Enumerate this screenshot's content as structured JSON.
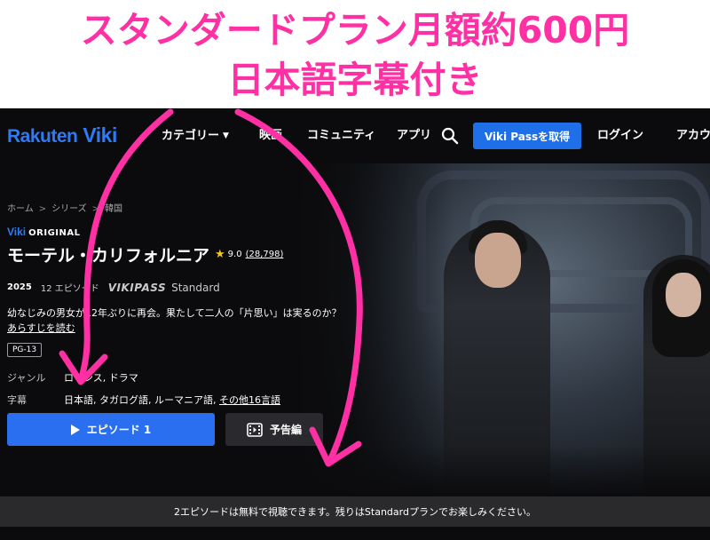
{
  "headline": {
    "line1": "スタンダードプラン月額約600円",
    "line2": "日本語字幕付き"
  },
  "nav": {
    "logo_left": "Rakuten",
    "logo_right": "Viki",
    "category": "カテゴリー",
    "movies": "映画",
    "community": "コミュニティ",
    "apps": "アプリ",
    "vikipass": "Viki Passを取得",
    "login": "ログイン",
    "account": "アカウ"
  },
  "breadcrumb": {
    "home": "ホーム",
    "series": "シリーズ",
    "korea": "韓国",
    "separator": ">"
  },
  "show": {
    "original_prefix": "Viki",
    "original_suffix": "ORIGINAL",
    "title": "モーテル・カリフォルニア",
    "star": "★",
    "rating": "9.0",
    "rating_count": "(28,798)",
    "year": "2025",
    "episodes": "12 エピソード",
    "vikipass": "VIKIPASS",
    "plan": "Standard",
    "synopsis": "幼なじみの男女が12年ぶりに再会。果たして二人の「片思い」は実るのか？",
    "read_more": "あらすじを読む",
    "age_rating": "PG-13",
    "genre_label": "ジャンル",
    "genre_value": "ロマンス, ドラマ",
    "subs_label": "字幕",
    "subs_value": "日本語, タガログ語, ルーマニア語, ",
    "subs_more": "その他16言語",
    "play_label": "エピソード 1",
    "trailer_label": "予告編"
  },
  "bottom_bar": {
    "message": "2エピソードは無料で視聴できます。残りはStandardプランでお楽しみください。"
  },
  "colors": {
    "accent_pink": "#ff2fa4",
    "brand_blue": "#2f7bf5",
    "button_blue": "#2a6ff0",
    "star_yellow": "#f5c518"
  }
}
